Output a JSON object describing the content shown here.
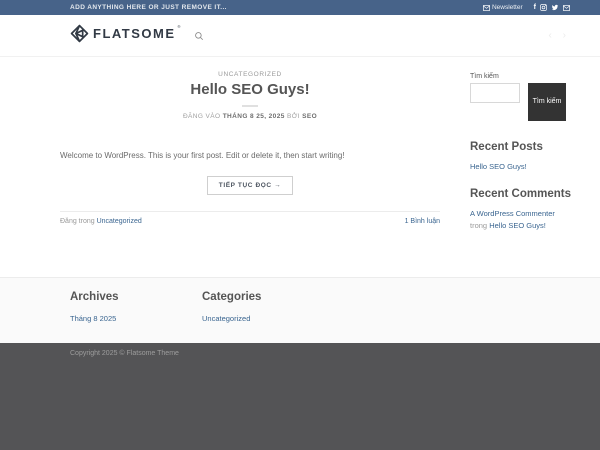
{
  "topbar": {
    "left_text": "ADD ANYTHING HERE OR JUST REMOVE IT...",
    "newsletter_label": "Newsletter",
    "facebook_glyph": "f"
  },
  "header": {
    "logo_text": "FLATSOME",
    "registered_mark": "®",
    "faint_glyphs": "‹ ›"
  },
  "post": {
    "category": "UNCATEGORIZED",
    "title": "Hello SEO Guys!",
    "meta_prefix": "ĐĂNG VÀO",
    "meta_date": "THÁNG 8 25, 2025",
    "meta_by": "BỞI",
    "meta_author": "SEO",
    "excerpt": "Welcome to WordPress. This is your first post. Edit or delete it, then start writing!",
    "read_more_label": "TIẾP TỤC ĐỌC →",
    "posted_in_prefix": "Đăng trong",
    "posted_in_link": "Uncategorized",
    "comments_link": "1 Bình luận"
  },
  "sidebar": {
    "search_label": "Tìm kiếm",
    "search_button_label": "Tìm kiếm",
    "search_input_value": "",
    "recent_posts_title": "Recent Posts",
    "recent_posts": [
      "Hello SEO Guys!"
    ],
    "recent_comments_title": "Recent Comments",
    "recent_comments": [
      {
        "author": "A WordPress Commenter",
        "connector": "trong",
        "post": "Hello SEO Guys!"
      }
    ]
  },
  "footer": {
    "archives_title": "Archives",
    "archives": [
      "Tháng 8 2025"
    ],
    "categories_title": "Categories",
    "categories": [
      "Uncategorized"
    ],
    "copyright": "Copyright 2025 © Flatsome Theme"
  },
  "icons": {
    "newsletter": "envelope",
    "social": [
      "facebook",
      "instagram",
      "twitter",
      "email"
    ],
    "header_search": "magnifier",
    "logo": "flatsome-gem"
  },
  "colors": {
    "topbar_bg": "#476389",
    "link": "#3a6590",
    "dark_footer_bg": "#545456",
    "search_button_bg": "#333333",
    "heading": "#555555"
  }
}
